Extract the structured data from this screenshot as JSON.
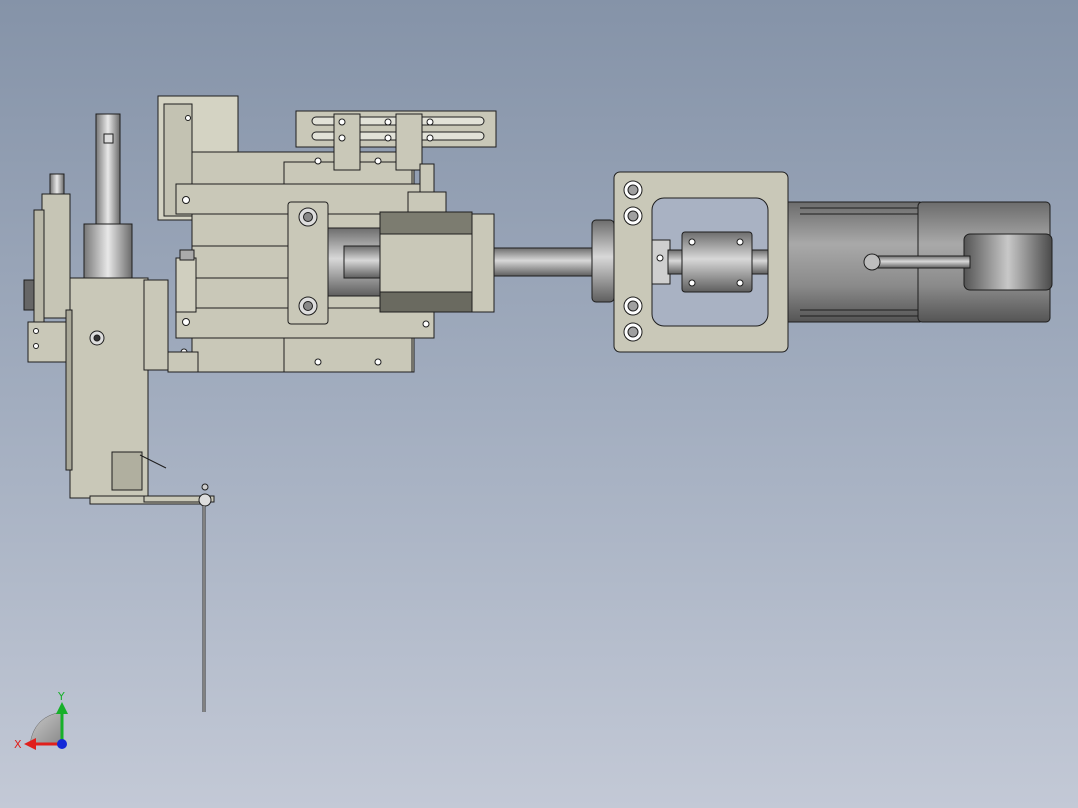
{
  "viewport": {
    "background_top": "#8593a8",
    "background_bottom": "#c3c9d6"
  },
  "model": {
    "part_fill": "#c9c8b8",
    "part_fill_dark": "#a9a898",
    "edge_color": "#1e1e1e",
    "motor_body": "#8a8a8a",
    "motor_dark": "#5a5a5a"
  },
  "triad": {
    "x_label": "X",
    "y_label": "Y",
    "x_color": "#e0201c",
    "y_color": "#17b02a",
    "z_color": "#1428d8"
  }
}
